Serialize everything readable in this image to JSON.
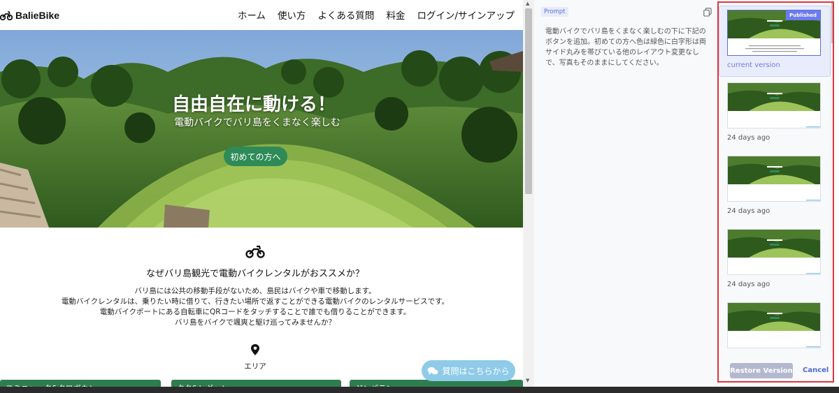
{
  "site": {
    "brand": "BalieBike",
    "nav": [
      "ホーム",
      "使い方",
      "よくある質問",
      "料金",
      "ログイン/サインアップ"
    ],
    "hero": {
      "title": "自由自在に動ける！",
      "subtitle": "電動バイクでバリ島をくまなく楽しむ",
      "button": "初めての方へ"
    },
    "section": {
      "title": "なぜバリ島観光で電動バイクレンタルがおススメか？",
      "body": [
        "バリ島には公共の移動手段がないため、島民はバイクや車で移動します。",
        "電動バイクレンタルは、乗りたい時に借りて、行きたい場所で返すことができる電動バイクのレンタルサービスです。",
        "電動バイクポートにある自転車にQRコードをタッチすることで誰でも借りることができます。",
        "バリ島をバイクで颯爽と駆け巡ってみませんか？"
      ],
      "area_label": "エリア"
    },
    "area_tabs": [
      "スミニャック&クロボカン",
      "クタ&レギャン",
      "ジンバラン"
    ],
    "chat_button": "質問はこちらから",
    "colors": {
      "accent_green": "#2e8b57",
      "chat_blue": "#8fcbe9"
    }
  },
  "prompt_panel": {
    "chip": "Prompt",
    "text": "電動バイクでバリ島をくまなく楽しむの下に下記のボタンを追加。初めての方へ色は緑色に白字形は両サイド丸みを帯びている他のレイアウト変更なしで、写真もそのままにしてください。"
  },
  "versions": {
    "badge": "Published",
    "items": [
      {
        "label": "current version",
        "selected": true
      },
      {
        "label": "24 days ago",
        "selected": false
      },
      {
        "label": "24 days ago",
        "selected": false
      },
      {
        "label": "24 days ago",
        "selected": false
      },
      {
        "label": "",
        "selected": false
      }
    ],
    "restore_button": "Restore Version",
    "cancel_button": "Cancel",
    "colors": {
      "highlight_border": "#e0353b",
      "accent": "#6c7bf0"
    }
  }
}
